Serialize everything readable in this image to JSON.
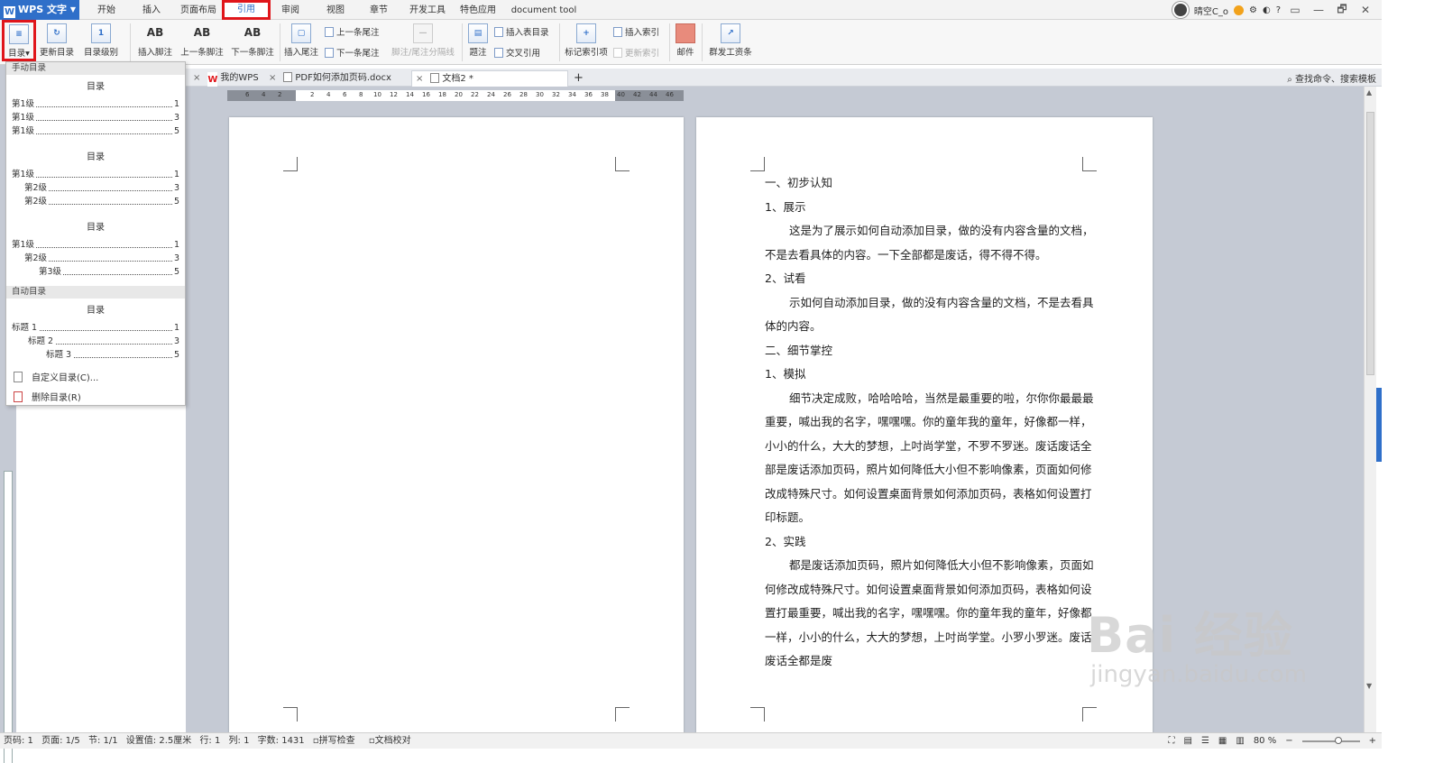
{
  "app": {
    "name": "WPS 文字"
  },
  "menu_tabs": [
    "开始",
    "插入",
    "页面布局",
    "引用",
    "审阅",
    "视图",
    "章节",
    "开发工具",
    "特色应用",
    "document tool"
  ],
  "active_tab": "引用",
  "title_right": {
    "user": "晴空C_o",
    "win_buttons": [
      "▭",
      "—",
      "🗗",
      "✕"
    ]
  },
  "ribbon": {
    "toc": "目录",
    "update_toc": "更新目录",
    "toc_level": "目录级别",
    "insert_footnote": "插入脚注",
    "prev_footnote": "上一条脚注",
    "next_footnote": "下一条脚注",
    "insert_endnote": "插入尾注",
    "prev_endnote": "上一条尾注",
    "next_endnote": "下一条尾注",
    "footnote_sep": "脚注/尾注分隔线",
    "caption": "题注",
    "insert_table_toc": "插入表目录",
    "cross_ref": "交叉引用",
    "mark_index": "标记索引项",
    "insert_index": "插入索引",
    "update_index": "更新索引",
    "mail": "邮件",
    "payroll": "群发工资条"
  },
  "doc_tabs": [
    "我的WPS",
    "PDF如何添加页码.docx",
    "文档2 *"
  ],
  "search_cmd": "查找命令、搜索模板",
  "toc_dropdown": {
    "manual_header": "手动目录",
    "auto_header": "自动目录",
    "samples": [
      {
        "title": "目录",
        "lines": [
          {
            "label": "第1级",
            "page": "1",
            "indent": 0
          },
          {
            "label": "第1级",
            "page": "3",
            "indent": 0
          },
          {
            "label": "第1级",
            "page": "5",
            "indent": 0
          }
        ]
      },
      {
        "title": "目录",
        "lines": [
          {
            "label": "第1级",
            "page": "1",
            "indent": 0
          },
          {
            "label": "第2级",
            "page": "3",
            "indent": 1
          },
          {
            "label": "第2级",
            "page": "5",
            "indent": 1
          }
        ]
      },
      {
        "title": "目录",
        "lines": [
          {
            "label": "第1级",
            "page": "1",
            "indent": 0
          },
          {
            "label": "第2级",
            "page": "3",
            "indent": 1
          },
          {
            "label": "第3级",
            "page": "5",
            "indent": 2
          }
        ]
      }
    ],
    "auto_sample": {
      "title": "目录",
      "lines": [
        {
          "label": "标题 1",
          "page": "1",
          "indent": 0
        },
        {
          "label": "标题 2",
          "page": "3",
          "indent": 1
        },
        {
          "label": "标题 3",
          "page": "5",
          "indent": 2
        }
      ]
    },
    "custom_toc": "自定义目录(C)...",
    "delete_toc": "删除目录(R)"
  },
  "ruler_numbers": [
    "6",
    "4",
    "2",
    "2",
    "4",
    "6",
    "8",
    "10",
    "12",
    "14",
    "16",
    "18",
    "20",
    "22",
    "24",
    "26",
    "28",
    "30",
    "32",
    "34",
    "36",
    "38",
    "40",
    "42",
    "44",
    "46"
  ],
  "document": {
    "paragraphs": [
      {
        "text": "一、初步认知",
        "indent": false
      },
      {
        "text": "1、展示",
        "indent": false
      },
      {
        "text": "这是为了展示如何自动添加目录，做的没有内容含量的文档，不是去看具体的内容。一下全部都是废话，得不得不得。",
        "indent": true
      },
      {
        "text": "2、试看",
        "indent": false
      },
      {
        "text": "示如何自动添加目录，做的没有内容含量的文档，不是去看具体的内容。",
        "indent": true
      },
      {
        "text": "二、细节掌控",
        "indent": false
      },
      {
        "text": "1、模拟",
        "indent": false
      },
      {
        "text": "细节决定成败，哈哈哈哈，当然是最重要的啦，尔你你最最最重要，喊出我的名字，嘿嘿嘿。你的童年我的童年，好像都一样，小小的什么，大大的梦想，上吋尚学堂，不罗不罗迷。废话废话全部是废话添加页码，照片如何降低大小但不影响像素，页面如何修改成特殊尺寸。如何设置桌面背景如何添加页码，表格如何设置打印标题。",
        "indent": true
      },
      {
        "text": "2、实践",
        "indent": false
      },
      {
        "text": "都是废话添加页码，照片如何降低大小但不影响像素，页面如何修改成特殊尺寸。如何设置桌面背景如何添加页码，表格如何设置打最重要，喊出我的名字，嘿嘿嘿。你的童年我的童年，好像都一样，小小的什么，大大的梦想，上吋尚学堂。小罗小罗迷。废话废话全都是废",
        "indent": true
      }
    ]
  },
  "status": {
    "items": [
      "页码: 1",
      "页面: 1/5",
      "节: 1/1",
      "设置值: 2.5厘米",
      "行: 1",
      "列: 1",
      "字数: 1431",
      "拼写检查",
      "文档校对"
    ],
    "zoom": "80 %"
  },
  "watermark": {
    "main": "Bai 经验",
    "sub": "jingyan.baidu.com"
  },
  "colors": {
    "accent": "#2f6fc9",
    "highlight": "#e0161b",
    "workspace": "#c5cad4"
  }
}
